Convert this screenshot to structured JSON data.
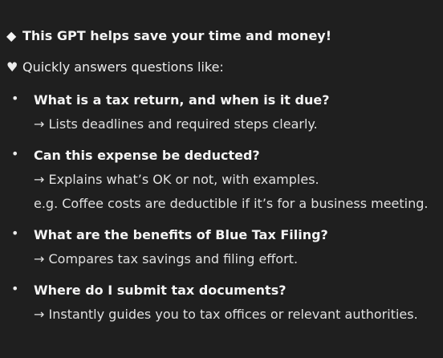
{
  "intro": {
    "headline": "This GPT helps save your time and money!",
    "headline_icon": "diamond-icon",
    "headline_icon_glyph": "◆",
    "subhead": "Quickly answers questions like:",
    "subhead_icon": "heart-icon",
    "subhead_icon_glyph": "♥"
  },
  "questions": [
    {
      "question": "What is a tax return, and when is it due?",
      "answer": "→ Lists deadlines and required steps clearly."
    },
    {
      "question": "Can this expense be deducted?",
      "answer": "→ Explains what’s OK or not, with examples.",
      "example": "e.g. Coffee costs are deductible if it’s for a business meeting."
    },
    {
      "question": "What are the benefits of Blue Tax Filing?",
      "answer": "→ Compares tax savings and filing effort."
    },
    {
      "question": "Where do I submit tax documents?",
      "answer": "→ Instantly guides you to tax offices or relevant authorities."
    }
  ],
  "bullet_glyph": "•",
  "colors": {
    "background": "#1f1f1f",
    "text": "#ececec"
  }
}
